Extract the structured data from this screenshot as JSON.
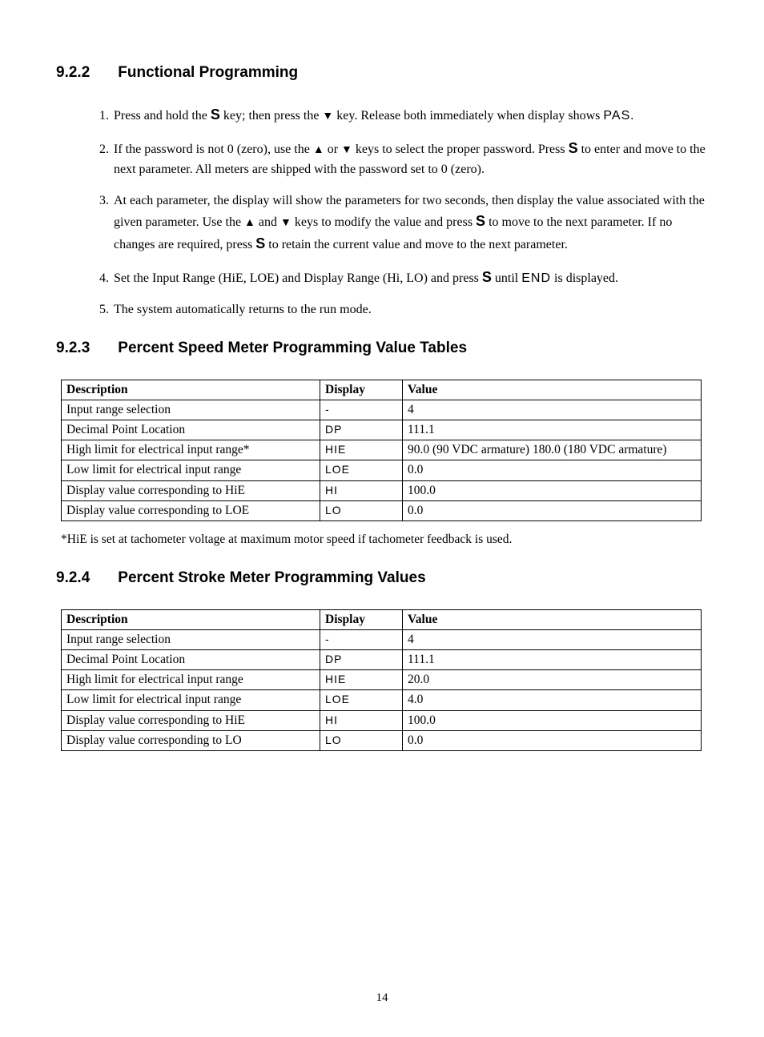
{
  "sections": {
    "s922": {
      "num": "9.2.2",
      "title": "Functional Programming"
    },
    "s923": {
      "num": "9.2.3",
      "title": "Percent Speed Meter Programming Value Tables"
    },
    "s924": {
      "num": "9.2.4",
      "title": "Percent Stroke Meter Programming Values"
    }
  },
  "glyphs": {
    "S": "S",
    "down": "▼",
    "up": "▲",
    "PAS": "PAS",
    "END": "END"
  },
  "steps": {
    "i1a": "Press and hold the ",
    "i1b": " key; then press the ",
    "i1c": " key.  Release both immediately when display shows ",
    "i1d": ".",
    "i2a": "If the password is not 0 (zero), use the ",
    "i2b": " or ",
    "i2c": " keys to select the proper password.  Press ",
    "i2d": " to enter and move to the next parameter.  All meters are shipped with the password set to 0 (zero).",
    "i3a": "At each parameter, the display will show the parameters for two seconds, then display the value associated with the given parameter.  Use the ",
    "i3b": " and ",
    "i3c": " keys to modify the value and press ",
    "i3d": " to move to the next parameter.  If no changes are required, press ",
    "i3e": " to retain the current value and move to the next parameter.",
    "i4a": "Set the Input Range (HiE, LOE) and Display Range (Hi, LO) and press ",
    "i4b": " until ",
    "i4c": " is displayed.",
    "i5": "The system automatically returns to the run mode."
  },
  "table_headers": {
    "desc": "Description",
    "disp": "Display",
    "val": "Value"
  },
  "table923": {
    "rows": [
      {
        "desc": "Input range selection",
        "disp": "-",
        "val": "4"
      },
      {
        "desc": "Decimal Point Location",
        "disp": "DP",
        "val": "111.1"
      },
      {
        "desc": "High limit for electrical input range*",
        "disp": "HIE",
        "val": "90.0 (90 VDC armature) 180.0 (180 VDC armature)"
      },
      {
        "desc": "Low limit for electrical input range",
        "disp": "LOE",
        "val": "0.0"
      },
      {
        "desc": "Display value corresponding to HiE",
        "disp": "HI",
        "val": "100.0"
      },
      {
        "desc": "Display value corresponding to LOE",
        "disp": "LO",
        "val": "0.0"
      }
    ],
    "footnote": "*HiE is set at tachometer voltage at maximum motor speed if tachometer feedback is used."
  },
  "table924": {
    "rows": [
      {
        "desc": "Input range selection",
        "disp": "-",
        "val": "4"
      },
      {
        "desc": "Decimal Point Location",
        "disp": "DP",
        "val": "111.1"
      },
      {
        "desc": "High limit for electrical input range",
        "disp": "HIE",
        "val": "20.0"
      },
      {
        "desc": "Low limit for electrical input range",
        "disp": "LOE",
        "val": "4.0"
      },
      {
        "desc": "Display value corresponding to HiE",
        "disp": "HI",
        "val": "100.0"
      },
      {
        "desc": "Display value corresponding to LO",
        "disp": "LO",
        "val": "0.0"
      }
    ]
  },
  "page_number": "14"
}
